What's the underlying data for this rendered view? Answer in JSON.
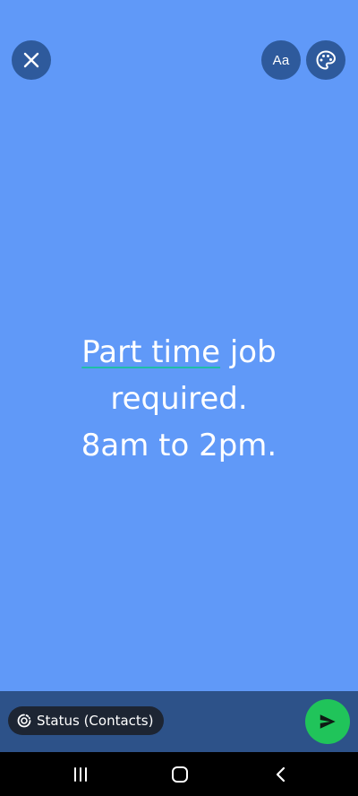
{
  "top_bar": {
    "close_icon": "close-icon",
    "font_button_label": "Aa",
    "palette_icon": "palette-icon"
  },
  "status": {
    "lines": [
      {
        "underlined": "Part time",
        "rest": " job"
      },
      {
        "underlined": "",
        "rest": "required."
      },
      {
        "underlined": "",
        "rest": "8am to 2pm."
      }
    ],
    "text_color": "#ffffff",
    "background_color": "#6099f8",
    "spellcheck_underline_color": "#1fbfa6"
  },
  "bottom_bar": {
    "audience_label": "Status (Contacts)",
    "audience_icon": "status-ring-icon",
    "send_icon": "send-icon",
    "send_color": "#20c45a"
  },
  "nav_bar": {
    "recents_icon": "recents-icon",
    "home_icon": "home-icon",
    "back_icon": "back-icon"
  }
}
